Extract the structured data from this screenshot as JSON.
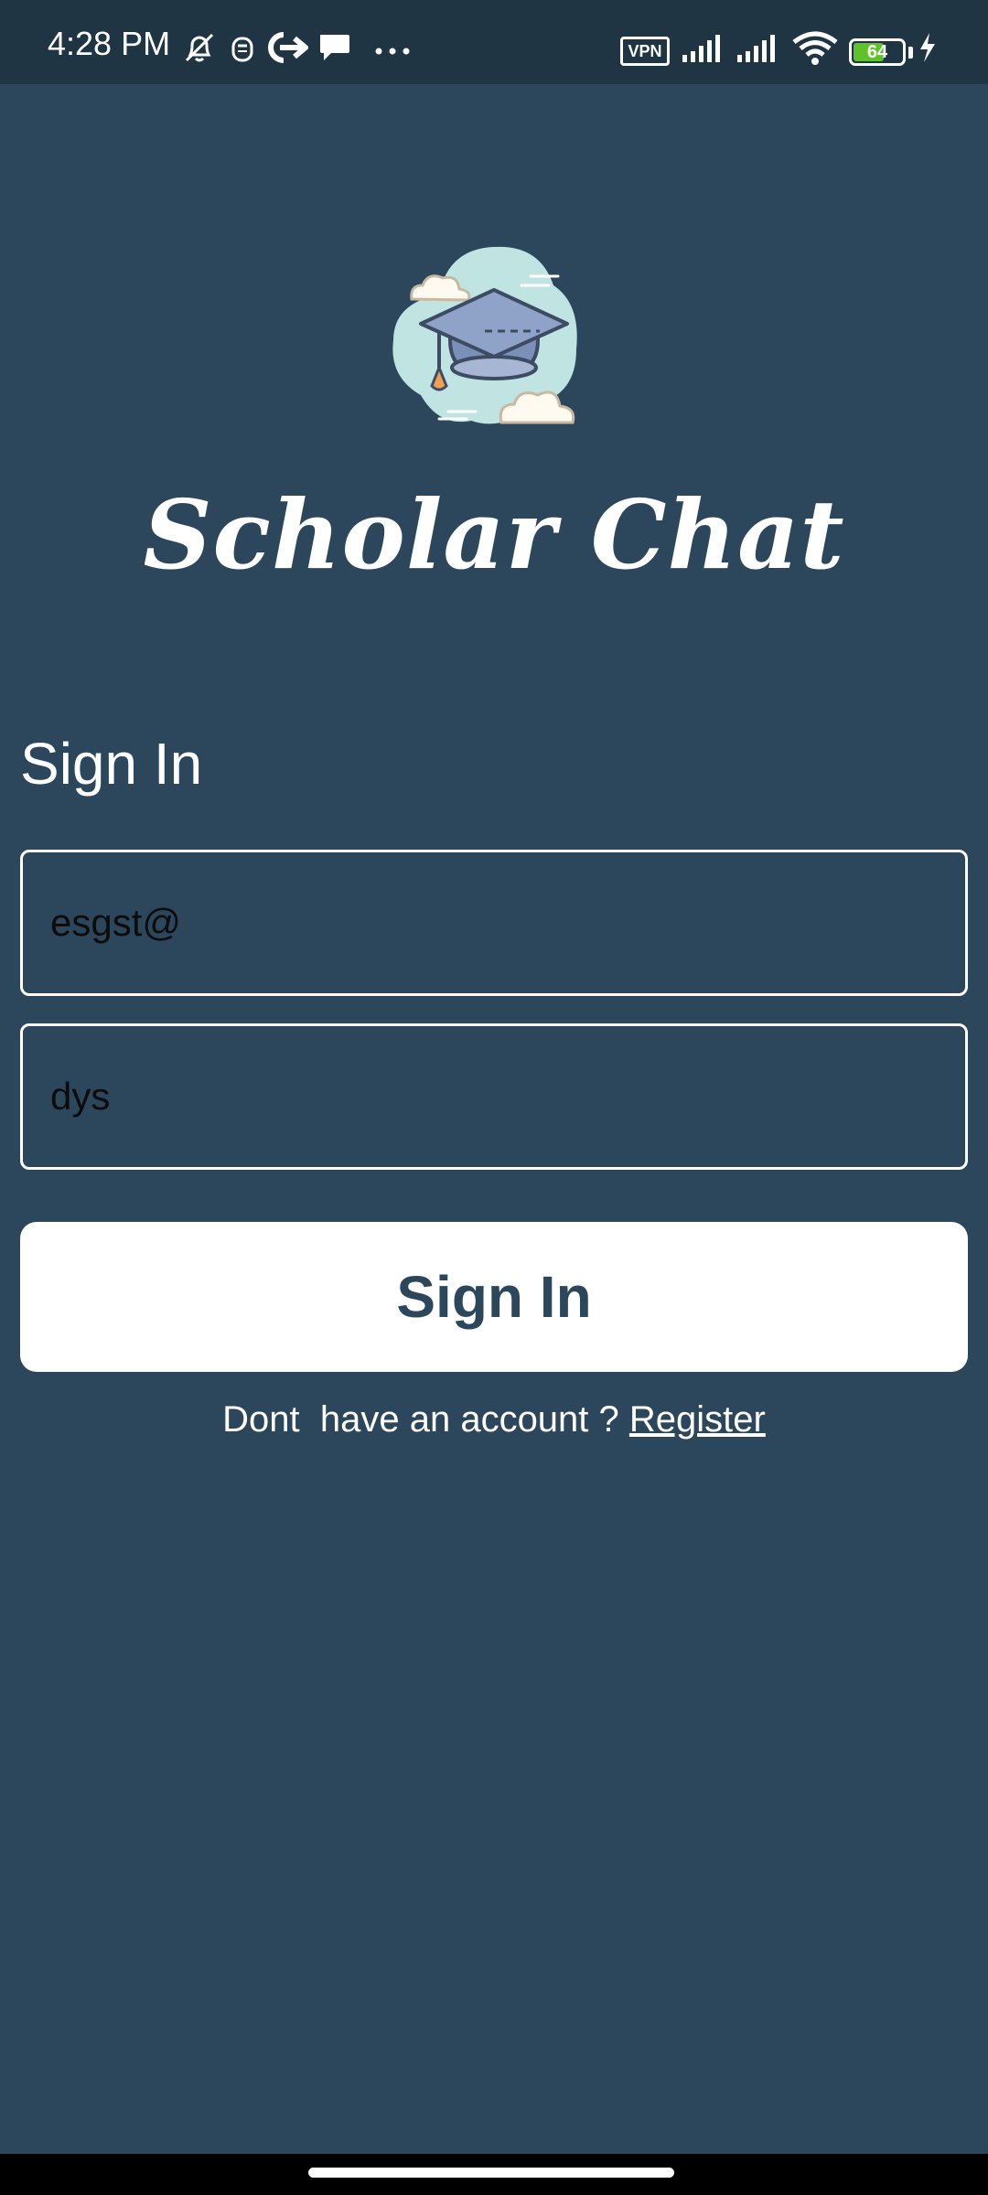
{
  "status_bar": {
    "time": "4:28 PM",
    "vpn_label": "VPN",
    "battery_level": "64",
    "battery_fraction": 0.64,
    "icons": [
      "bell-muted-icon",
      "notification-icon",
      "arrow-icon",
      "chat-icon",
      "more-icon",
      "signal-icon",
      "signal-icon",
      "wifi-icon",
      "battery-icon",
      "charging-icon"
    ]
  },
  "app": {
    "title": "Scholar Chat",
    "logo_icon": "graduation-cap-icon"
  },
  "form": {
    "heading": "Sign In",
    "email_value": "esgst@",
    "password_value": "dys",
    "submit_label": "Sign In"
  },
  "footer": {
    "prompt": "Dont  have an account ? ",
    "register_label": "Register"
  },
  "colors": {
    "background": "#2c475b",
    "status_bar": "#203543",
    "button_text": "#2c475b",
    "battery": "#5fc22a"
  }
}
